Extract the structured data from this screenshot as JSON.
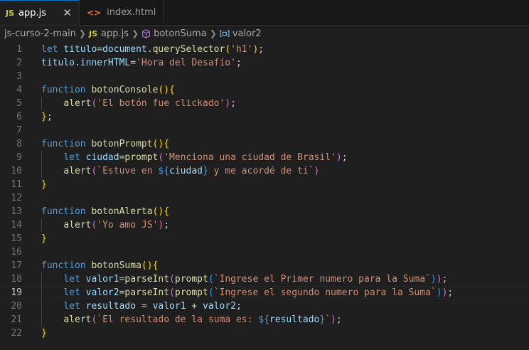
{
  "tabs": [
    {
      "icon": "JS",
      "label": "app.js",
      "active": true,
      "close": "✕"
    },
    {
      "icon": "<>",
      "label": "index.html",
      "active": false
    }
  ],
  "breadcrumb": {
    "folder": "js-curso-2-main",
    "file_icon": "JS",
    "file": "app.js",
    "function": "botonSuma",
    "variable": "valor2"
  },
  "editor": {
    "current_line": 19,
    "lines": [
      "let titulo=document.querySelector('h1');",
      "titulo.innerHTML='Hora del Desafío';",
      "",
      "function botonConsole(){",
      "    alert('El botón fue clickado');",
      "};",
      "",
      "function botonPrompt(){",
      "    let ciudad=prompt('Menciona una ciudad de Brasil');",
      "    alert(`Estuve en ${ciudad} y me acordé de ti`)",
      "}",
      "",
      "function botonAlerta(){",
      "    alert('Yo amo JS');",
      "}",
      "",
      "function botonSuma(){",
      "    let valor1=parseInt(prompt(`Ingrese el Primer numero para la Suma`));",
      "    let valor2=parseInt(prompt(`Ingrese el segundo numero para la Suma`));",
      "    let resultado = valor1 + valor2;",
      "    alert(`El resultado de la suma es: ${resultado}`);",
      "}"
    ]
  },
  "colors": {
    "keyword": "#569cd6",
    "function": "#dcdcaa",
    "variable": "#9cdcfe",
    "string": "#ce9178",
    "bracket1": "#ffd700",
    "bracket2": "#da70d6",
    "bracket3": "#179fff"
  }
}
